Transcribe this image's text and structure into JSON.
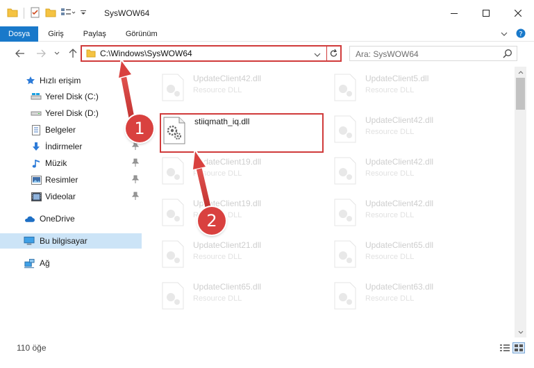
{
  "window": {
    "title": "SysWOW64"
  },
  "ribbon": {
    "tabs": [
      {
        "label": "Dosya",
        "active": true
      },
      {
        "label": "Giriş",
        "active": false
      },
      {
        "label": "Paylaş",
        "active": false
      },
      {
        "label": "Görünüm",
        "active": false
      }
    ]
  },
  "address": {
    "path": "C:\\Windows\\SysWOW64"
  },
  "search": {
    "placeholder": "Ara: SysWOW64"
  },
  "sidebar": {
    "items": [
      {
        "label": "Hızlı erişim",
        "icon": "star-icon"
      },
      {
        "label": "Yerel Disk (C:)",
        "icon": "drive-icon",
        "pinned": true
      },
      {
        "label": "Yerel Disk (D:)",
        "icon": "drive-icon",
        "pinned": true
      },
      {
        "label": "Belgeler",
        "icon": "document-icon",
        "pinned": true
      },
      {
        "label": "İndirmeler",
        "icon": "download-icon",
        "pinned": true
      },
      {
        "label": "Müzik",
        "icon": "music-icon",
        "pinned": true
      },
      {
        "label": "Resimler",
        "icon": "pictures-icon",
        "pinned": true
      },
      {
        "label": "Videolar",
        "icon": "video-icon",
        "pinned": true
      },
      {
        "label": "OneDrive",
        "icon": "cloud-icon"
      },
      {
        "label": "Bu bilgisayar",
        "icon": "computer-icon",
        "selected": true
      },
      {
        "label": "Ağ",
        "icon": "network-icon"
      }
    ]
  },
  "files": {
    "highlighted": {
      "name": "stiiqmath_iq.dll",
      "type": ""
    },
    "left": [
      {
        "name": "UpdateClient42.dll",
        "type": "Resource DLL"
      },
      {
        "name": "UpdateClient19.dll",
        "type": "Resource DLL"
      },
      {
        "name": "UpdateClient19.dll",
        "type": "Resource DLL"
      },
      {
        "name": "UpdateClient21.dll",
        "type": "Resource DLL"
      },
      {
        "name": "UpdateClient65.dll",
        "type": "Resource DLL"
      }
    ],
    "right": [
      {
        "name": "UpdateClient5.dll",
        "type": "Resource DLL"
      },
      {
        "name": "UpdateClient42.dll",
        "type": "Resource DLL"
      },
      {
        "name": "UpdateClient42.dll",
        "type": "Resource DLL"
      },
      {
        "name": "UpdateClient42.dll",
        "type": "Resource DLL"
      },
      {
        "name": "UpdateClient65.dll",
        "type": "Resource DLL"
      },
      {
        "name": "UpdateClient63.dll",
        "type": "Resource DLL"
      }
    ]
  },
  "status": {
    "count": "110 öğe"
  },
  "annotations": {
    "step1": "1",
    "step2": "2"
  },
  "colors": {
    "accent": "#1979ca",
    "highlight": "#d03a3a",
    "badge": "#d9413f",
    "selected_nav": "#cce4f7"
  }
}
